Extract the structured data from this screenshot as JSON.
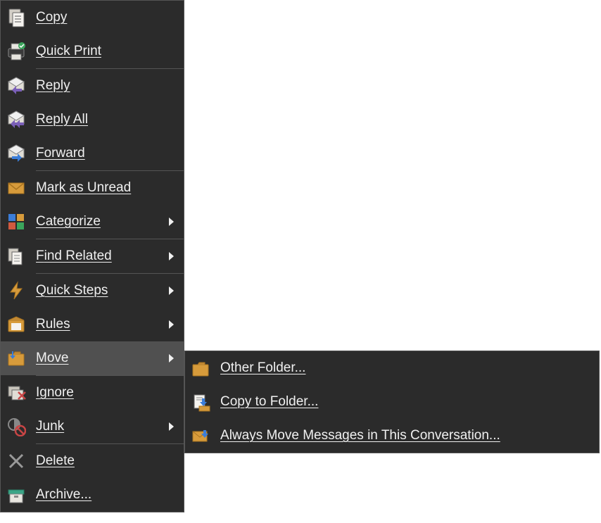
{
  "menu": {
    "items": [
      {
        "id": "copy",
        "label": "Copy",
        "u": 0,
        "icon": "copy-icon"
      },
      {
        "id": "quick-print",
        "label": "Quick Print",
        "u": -1,
        "icon": "quick-print-icon"
      },
      {
        "sep": true
      },
      {
        "id": "reply",
        "label": "Reply",
        "u": 0,
        "icon": "reply-icon"
      },
      {
        "id": "reply-all",
        "label": "Reply All",
        "u": 6,
        "icon": "reply-all-icon"
      },
      {
        "id": "forward",
        "label": "Forward",
        "u": 3,
        "icon": "forward-icon"
      },
      {
        "sep": true
      },
      {
        "id": "mark-unread",
        "label": "Mark as Unread",
        "u": 8,
        "icon": "mark-unread-icon"
      },
      {
        "id": "categorize",
        "label": "Categorize",
        "u": -1,
        "icon": "categorize-icon",
        "submenu": true
      },
      {
        "sep": true
      },
      {
        "id": "find-related",
        "label": "Find Related",
        "u": 0,
        "icon": "find-related-icon",
        "submenu": true
      },
      {
        "sep": true
      },
      {
        "id": "quick-steps",
        "label": "Quick Steps",
        "u": 0,
        "icon": "quick-steps-icon",
        "submenu": true
      },
      {
        "id": "rules",
        "label": "Rules",
        "u": 4,
        "icon": "rules-icon",
        "submenu": true
      },
      {
        "id": "move",
        "label": "Move",
        "u": 0,
        "icon": "move-icon",
        "submenu": true,
        "hover": true
      },
      {
        "sep": true
      },
      {
        "id": "ignore",
        "label": "Ignore",
        "u": -1,
        "icon": "ignore-icon"
      },
      {
        "id": "junk",
        "label": "Junk",
        "u": 0,
        "icon": "junk-icon",
        "submenu": true
      },
      {
        "sep": true
      },
      {
        "id": "delete",
        "label": "Delete",
        "u": 0,
        "icon": "delete-icon"
      },
      {
        "id": "archive",
        "label": "Archive...",
        "u": -1,
        "icon": "archive-icon"
      }
    ]
  },
  "submenu": {
    "items": [
      {
        "id": "other-folder",
        "label": "Other Folder...",
        "u": 0,
        "icon": "other-folder-icon"
      },
      {
        "id": "copy-to-folder",
        "label": "Copy to Folder...",
        "u": 0,
        "icon": "copy-to-folder-icon"
      },
      {
        "id": "always-move",
        "label": "Always Move Messages in This Conversation...",
        "u": 0,
        "icon": "always-move-icon"
      }
    ]
  }
}
